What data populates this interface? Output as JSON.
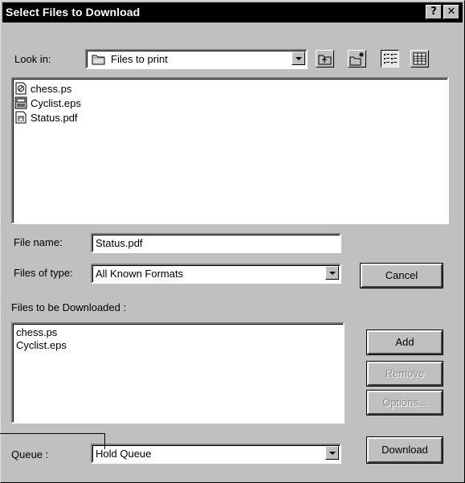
{
  "window": {
    "title": "Select Files to Download",
    "help_button": "?",
    "close_button": "✕"
  },
  "look_in": {
    "label": "Look in:",
    "value": "Files to print"
  },
  "file_browser": {
    "files": [
      {
        "name": "chess.ps",
        "icon": "postscript-file-icon"
      },
      {
        "name": "Cyclist.eps",
        "icon": "eps-file-icon"
      },
      {
        "name": "Status.pdf",
        "icon": "pdf-file-icon"
      }
    ]
  },
  "file_name": {
    "label": "File name:",
    "value": "Status.pdf"
  },
  "files_of_type": {
    "label": "Files of type:",
    "value": "All Known Formats"
  },
  "download_list": {
    "label": "Files to be Downloaded :",
    "items": [
      "chess.ps",
      "Cyclist.eps"
    ]
  },
  "queue": {
    "label": "Queue :",
    "value": "Hold Queue"
  },
  "buttons": {
    "cancel": "Cancel",
    "add": "Add",
    "remove": "Remove",
    "options": "Options...",
    "download": "Download"
  },
  "colors": {
    "titlebar": "#000000",
    "face": "#c0c0c0",
    "field": "#ffffff",
    "disabled_text": "#8a8a8a"
  }
}
